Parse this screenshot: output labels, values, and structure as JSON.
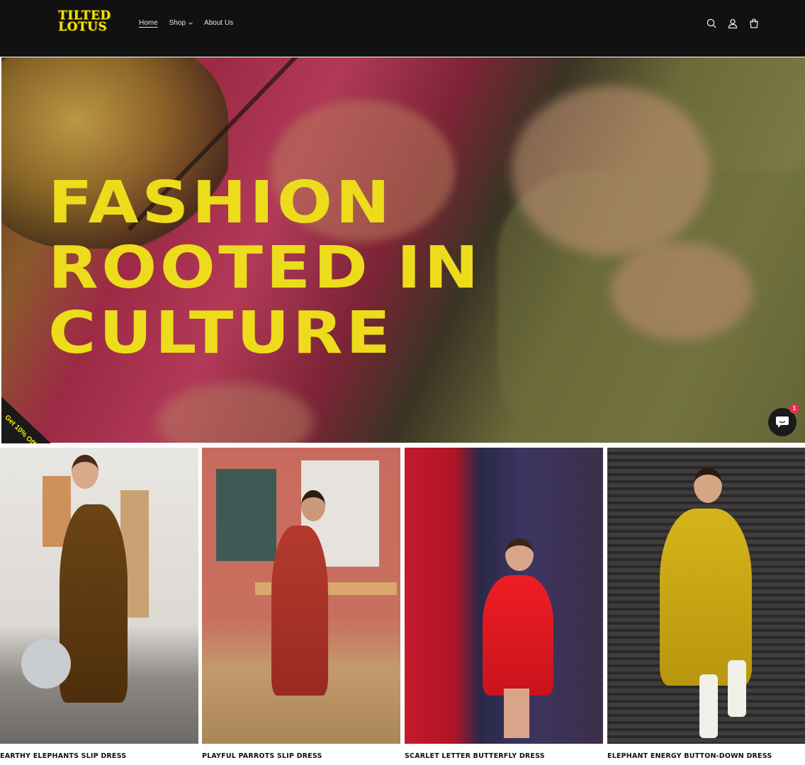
{
  "header": {
    "logo": {
      "line1": "TILTED",
      "line2": "LOTUS"
    },
    "nav": [
      {
        "label": "Home",
        "active": true
      },
      {
        "label": "Shop",
        "has_dropdown": true
      },
      {
        "label": "About Us"
      }
    ],
    "icons": [
      "search-icon",
      "account-icon",
      "cart-icon"
    ]
  },
  "hero": {
    "title_lines": [
      "FASHION",
      "ROOTED IN",
      "CULTURE"
    ],
    "promo_badge": "Get 10% Off",
    "chat_badge_count": "1"
  },
  "products": [
    {
      "name": "EARTHY ELEPHANTS SLIP DRESS"
    },
    {
      "name": "PLAYFUL PARROTS SLIP DRESS"
    },
    {
      "name": "SCARLET LETTER BUTTERFLY DRESS"
    },
    {
      "name": "ELEPHANT ENERGY BUTTON-DOWN DRESS"
    }
  ],
  "colors": {
    "header_bg": "#111111",
    "accent_yellow": "#ecdc1c",
    "badge_red": "#e0314b"
  }
}
